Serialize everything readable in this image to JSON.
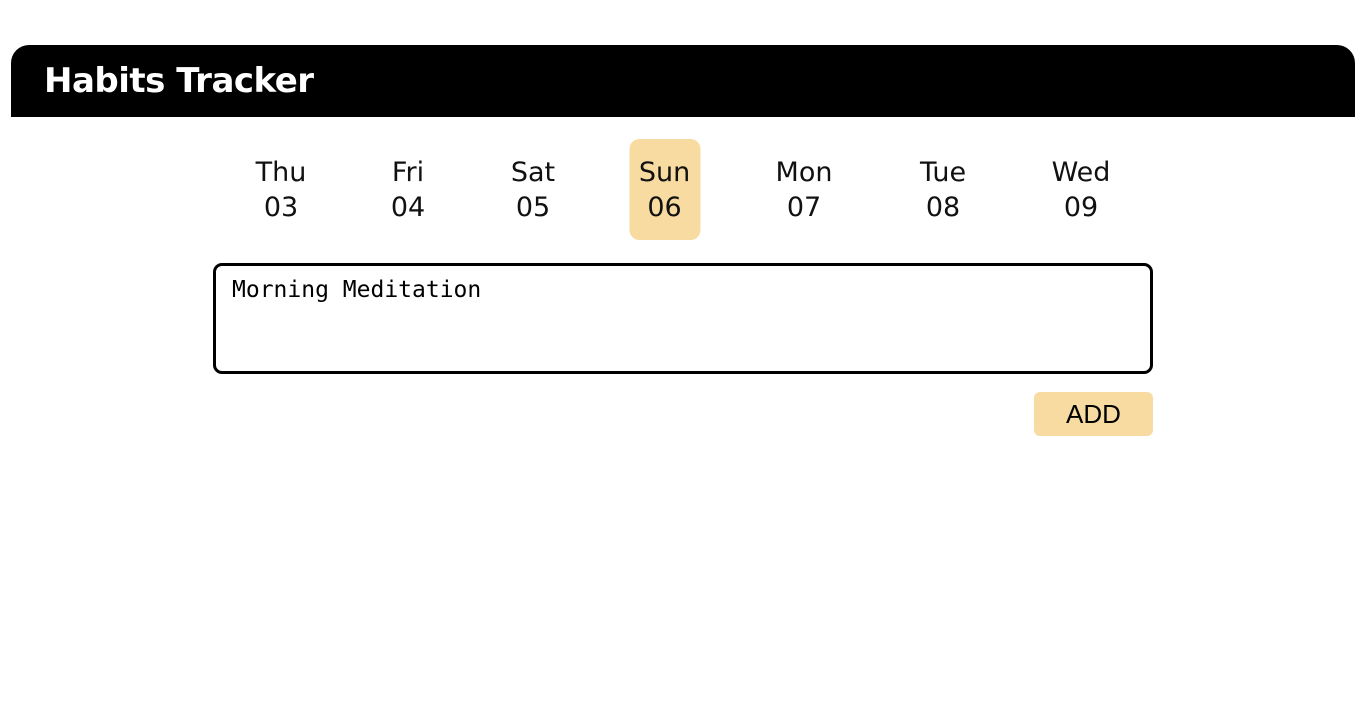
{
  "header": {
    "title": "Habits Tracker"
  },
  "days": [
    {
      "weekday": "Thu",
      "date": "03",
      "selected": false
    },
    {
      "weekday": "Fri",
      "date": "04",
      "selected": false
    },
    {
      "weekday": "Sat",
      "date": "05",
      "selected": false
    },
    {
      "weekday": "Sun",
      "date": "06",
      "selected": true
    },
    {
      "weekday": "Mon",
      "date": "07",
      "selected": false
    },
    {
      "weekday": "Tue",
      "date": "08",
      "selected": false
    },
    {
      "weekday": "Wed",
      "date": "09",
      "selected": false
    }
  ],
  "habit_input": {
    "value": "Morning Meditation"
  },
  "add_button": {
    "label": "ADD"
  },
  "colors": {
    "header_bg": "#000000",
    "accent": "#f8dba0"
  }
}
